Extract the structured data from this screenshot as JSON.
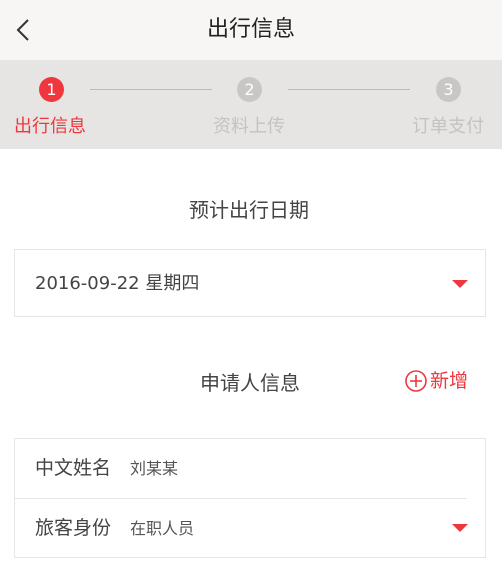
{
  "nav": {
    "title": "出行信息"
  },
  "steps": [
    {
      "number": "1",
      "label": "出行信息"
    },
    {
      "number": "2",
      "label": "资料上传"
    },
    {
      "number": "3",
      "label": "订单支付"
    }
  ],
  "trip_date": {
    "section_title": "预计出行日期",
    "value": "2016-09-22 星期四"
  },
  "applicant": {
    "section_title": "申请人信息",
    "add_label": "新增",
    "name_label": "中文姓名",
    "name_value": "刘某某",
    "identity_label": "旅客身份",
    "identity_value": "在职人员"
  },
  "colors": {
    "accent": "#f0373d",
    "step_inactive": "#c8c7c5",
    "steps_bg": "#e6e5e3"
  }
}
